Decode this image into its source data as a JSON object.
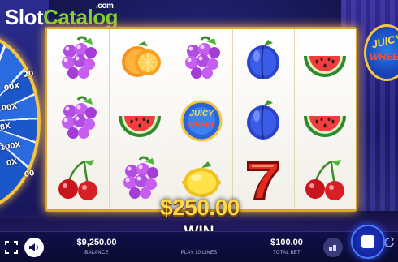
{
  "watermark": {
    "slot": "Slot",
    "catalog": "Catalog",
    "com": ".com"
  },
  "wheel": {
    "labels": [
      "20",
      "00X",
      "00X",
      "8X",
      "100X",
      "0X",
      "00"
    ]
  },
  "logo": {
    "line1": "JUICY",
    "line2": "WHEEL"
  },
  "reels": [
    [
      "grapes",
      "grapes",
      "cherries"
    ],
    [
      "orange",
      "watermelon",
      "grapes"
    ],
    [
      "grapes",
      "juicy-wheel",
      "lemon"
    ],
    [
      "plum",
      "plum",
      "seven"
    ],
    [
      "watermelon",
      "watermelon",
      "cherries"
    ]
  ],
  "win": {
    "amount": "$250.00",
    "label": "WIN"
  },
  "bottom": {
    "balance_value": "$9,250.00",
    "balance_label": "BALANCE",
    "lines_label": "PLAY 10 LINES",
    "bet_value": "$100.00",
    "bet_label": "TOTAL BET"
  },
  "icons": [
    "fullscreen-icon",
    "sound-icon",
    "coins-icon",
    "autoplay-icon",
    "spin-stop-icon"
  ],
  "colors": {
    "win": "#ffd84a",
    "frame": "#d9a532",
    "watermark_green": "#7fd12c"
  }
}
